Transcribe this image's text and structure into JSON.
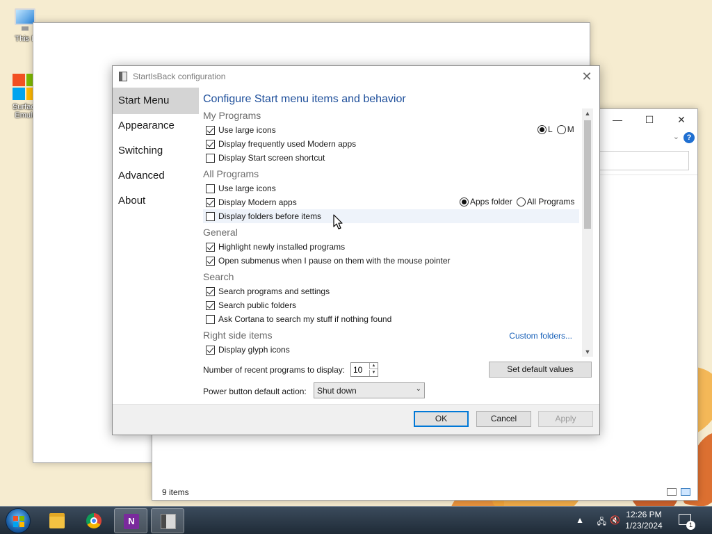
{
  "desktop": {
    "icons": [
      {
        "label": "This P",
        "icon": "this-pc-icon"
      },
      {
        "label": "Surface\nEmula",
        "icon": "surface-emulator-icon"
      }
    ]
  },
  "background_windows": {
    "explorer": {
      "status": "9 items",
      "controls": [
        "—",
        "☐",
        "✕"
      ]
    }
  },
  "dialog": {
    "title": "StartIsBack configuration",
    "close_label": "✕",
    "nav": [
      {
        "label": "Start Menu",
        "selected": true
      },
      {
        "label": "Appearance",
        "selected": false
      },
      {
        "label": "Switching",
        "selected": false
      },
      {
        "label": "Advanced",
        "selected": false
      },
      {
        "label": "About",
        "selected": false
      }
    ],
    "heading": "Configure Start menu items and behavior",
    "groups": {
      "my_programs": {
        "title": "My Programs",
        "items": [
          {
            "label": "Use large icons",
            "checked": true
          },
          {
            "label": "Display frequently used Modern apps",
            "checked": true
          },
          {
            "label": "Display Start screen shortcut",
            "checked": false
          }
        ],
        "size_options": [
          {
            "label": "L",
            "selected": true
          },
          {
            "label": "M",
            "selected": false
          }
        ]
      },
      "all_programs": {
        "title": "All Programs",
        "items": [
          {
            "label": "Use large icons",
            "checked": false
          },
          {
            "label": "Display Modern apps",
            "checked": true
          },
          {
            "label": "Display folders before items",
            "checked": false
          }
        ],
        "modern_apps_options": [
          {
            "label": "Apps folder",
            "selected": true
          },
          {
            "label": "All Programs",
            "selected": false
          }
        ]
      },
      "general": {
        "title": "General",
        "items": [
          {
            "label": "Highlight newly installed programs",
            "checked": true
          },
          {
            "label": "Open submenus when I pause on them with the mouse pointer",
            "checked": true
          }
        ]
      },
      "search": {
        "title": "Search",
        "items": [
          {
            "label": "Search programs and settings",
            "checked": true
          },
          {
            "label": "Search public folders",
            "checked": true
          },
          {
            "label": "Ask Cortana to search my stuff if nothing found",
            "checked": false
          }
        ]
      },
      "right_side": {
        "title": "Right side items",
        "link": "Custom folders...",
        "items": [
          {
            "label": "Display glyph icons",
            "checked": true
          }
        ]
      }
    },
    "recent_programs": {
      "label": "Number of recent programs to display:",
      "value": "10"
    },
    "set_default_label": "Set default values",
    "power_button": {
      "label": "Power button default action:",
      "value": "Shut down"
    },
    "buttons": {
      "ok": "OK",
      "cancel": "Cancel",
      "apply": "Apply"
    }
  },
  "taskbar": {
    "apps": [
      {
        "name": "file-explorer",
        "active": false
      },
      {
        "name": "chrome",
        "active": false
      },
      {
        "name": "onenote",
        "active": true
      },
      {
        "name": "startisback-config",
        "active": true
      }
    ],
    "onenote_letter": "N",
    "time": "12:26 PM",
    "date": "1/23/2024",
    "notification_count": "1",
    "accent": "#1f6fd1"
  }
}
